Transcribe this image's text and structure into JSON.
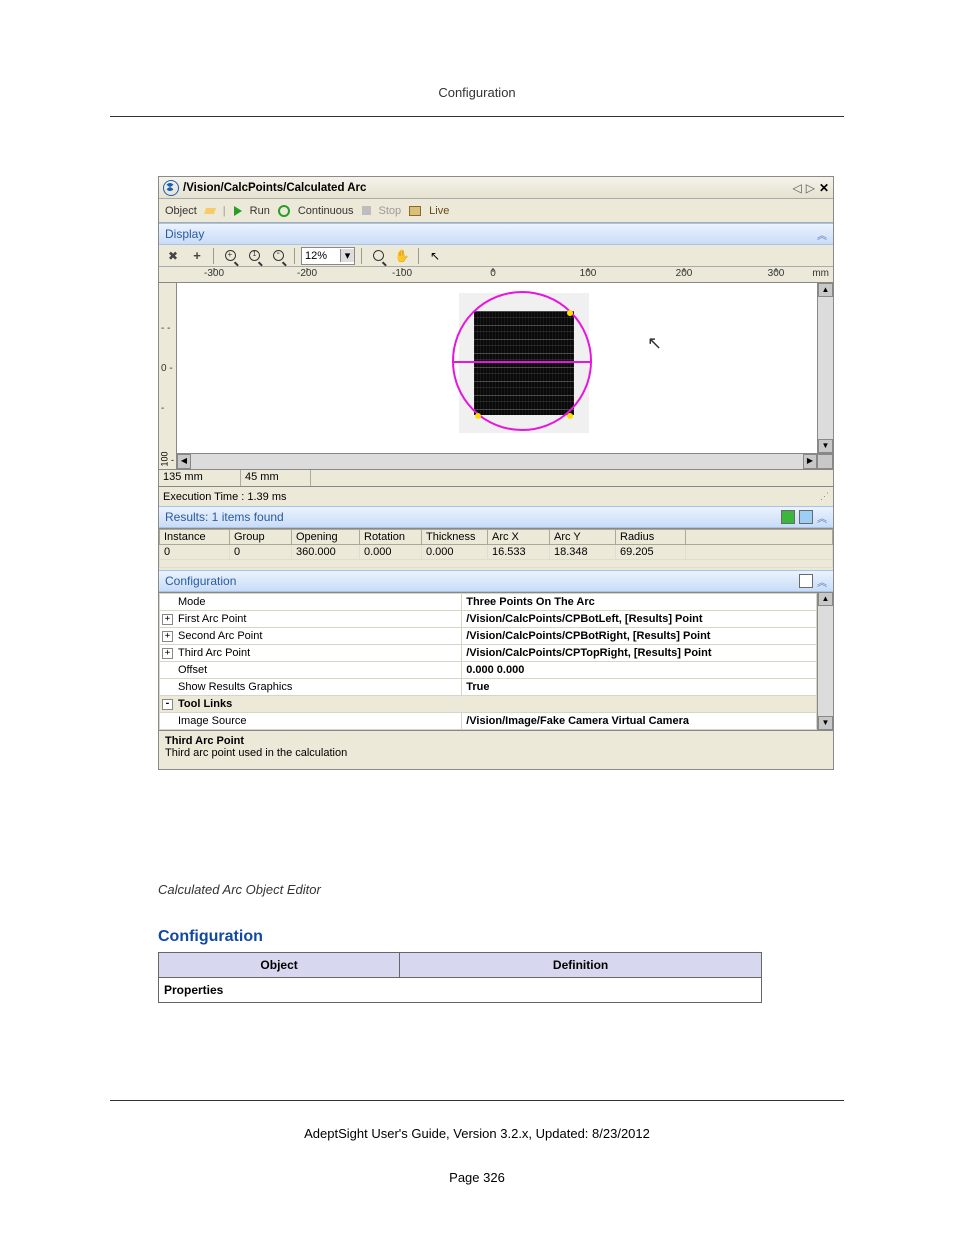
{
  "page": {
    "header": "Configuration",
    "caption": "Calculated Arc Object Editor",
    "config_heading": "Configuration",
    "def_table": {
      "object_hdr": "Object",
      "definition_hdr": "Definition",
      "row_label": "Properties"
    },
    "footer_guide": "AdeptSight User's Guide,  Version 3.2.x, Updated: 8/23/2012",
    "page_num": "Page 326"
  },
  "window": {
    "title": "/Vision/CalcPoints/Calculated Arc",
    "commands": {
      "object": "Object",
      "run": "Run",
      "continuous": "Continuous",
      "stop": "Stop",
      "live": "Live"
    },
    "display_label": "Display",
    "zoom_value": "12%",
    "ruler": {
      "marks": [
        "-300",
        "-200",
        "-100",
        "0",
        "100",
        "200",
        "300"
      ],
      "unit": "mm",
      "vmark": "0",
      "hscroll_left": "100"
    },
    "status": {
      "cell1": "135 mm",
      "cell2": "45 mm",
      "exec": "Execution Time : 1.39 ms"
    },
    "results": {
      "header": "Results: 1 items found",
      "columns": [
        "Instance",
        "Group",
        "Opening",
        "Rotation",
        "Thickness",
        "Arc X",
        "Arc Y",
        "Radius"
      ],
      "rows": [
        [
          "0",
          "0",
          "360.000",
          "0.000",
          "0.000",
          "16.533",
          "18.348",
          "69.205"
        ]
      ]
    },
    "config": {
      "header": "Configuration",
      "rows": [
        {
          "type": "row",
          "expand": null,
          "name": "Mode",
          "value": "Three Points On The Arc"
        },
        {
          "type": "row",
          "expand": "+",
          "name": "First Arc Point",
          "value": "/Vision/CalcPoints/CPBotLeft, [Results] Point"
        },
        {
          "type": "row",
          "expand": "+",
          "name": "Second Arc Point",
          "value": "/Vision/CalcPoints/CPBotRight, [Results] Point"
        },
        {
          "type": "row",
          "expand": "+",
          "name": "Third Arc Point",
          "value": "/Vision/CalcPoints/CPTopRight, [Results] Point"
        },
        {
          "type": "row",
          "expand": null,
          "name": "Offset",
          "value": "0.000 0.000"
        },
        {
          "type": "row",
          "expand": null,
          "name": "Show Results Graphics",
          "value": "True"
        },
        {
          "type": "cat",
          "expand": "-",
          "name": "Tool Links",
          "value": ""
        },
        {
          "type": "row",
          "expand": null,
          "name": "Image Source",
          "value": "/Vision/Image/Fake Camera Virtual Camera"
        }
      ],
      "help_title": "Third Arc Point",
      "help_text": "Third arc point used in the calculation"
    }
  }
}
